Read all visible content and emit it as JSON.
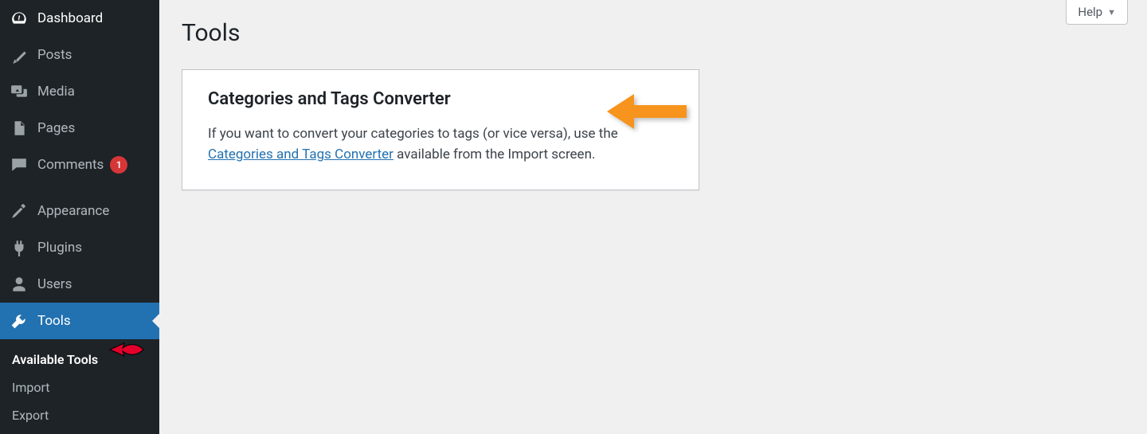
{
  "sidebar": {
    "items": [
      {
        "label": "Dashboard",
        "icon": "dashboard-icon"
      },
      {
        "label": "Posts",
        "icon": "pin-icon"
      },
      {
        "label": "Media",
        "icon": "media-icon"
      },
      {
        "label": "Pages",
        "icon": "pages-icon"
      },
      {
        "label": "Comments",
        "icon": "comment-icon",
        "badge": "1"
      },
      {
        "label": "Appearance",
        "icon": "brush-icon"
      },
      {
        "label": "Plugins",
        "icon": "plug-icon"
      },
      {
        "label": "Users",
        "icon": "user-icon"
      },
      {
        "label": "Tools",
        "icon": "wrench-icon"
      }
    ],
    "submenu": [
      {
        "label": "Available Tools"
      },
      {
        "label": "Import"
      },
      {
        "label": "Export"
      }
    ]
  },
  "header": {
    "help": "Help"
  },
  "page": {
    "title": "Tools"
  },
  "card": {
    "title": "Categories and Tags Converter",
    "text_before": "If you want to convert your categories to tags (or vice versa), use the ",
    "link": "Categories and Tags Converter",
    "text_after": " available from the Import screen."
  }
}
